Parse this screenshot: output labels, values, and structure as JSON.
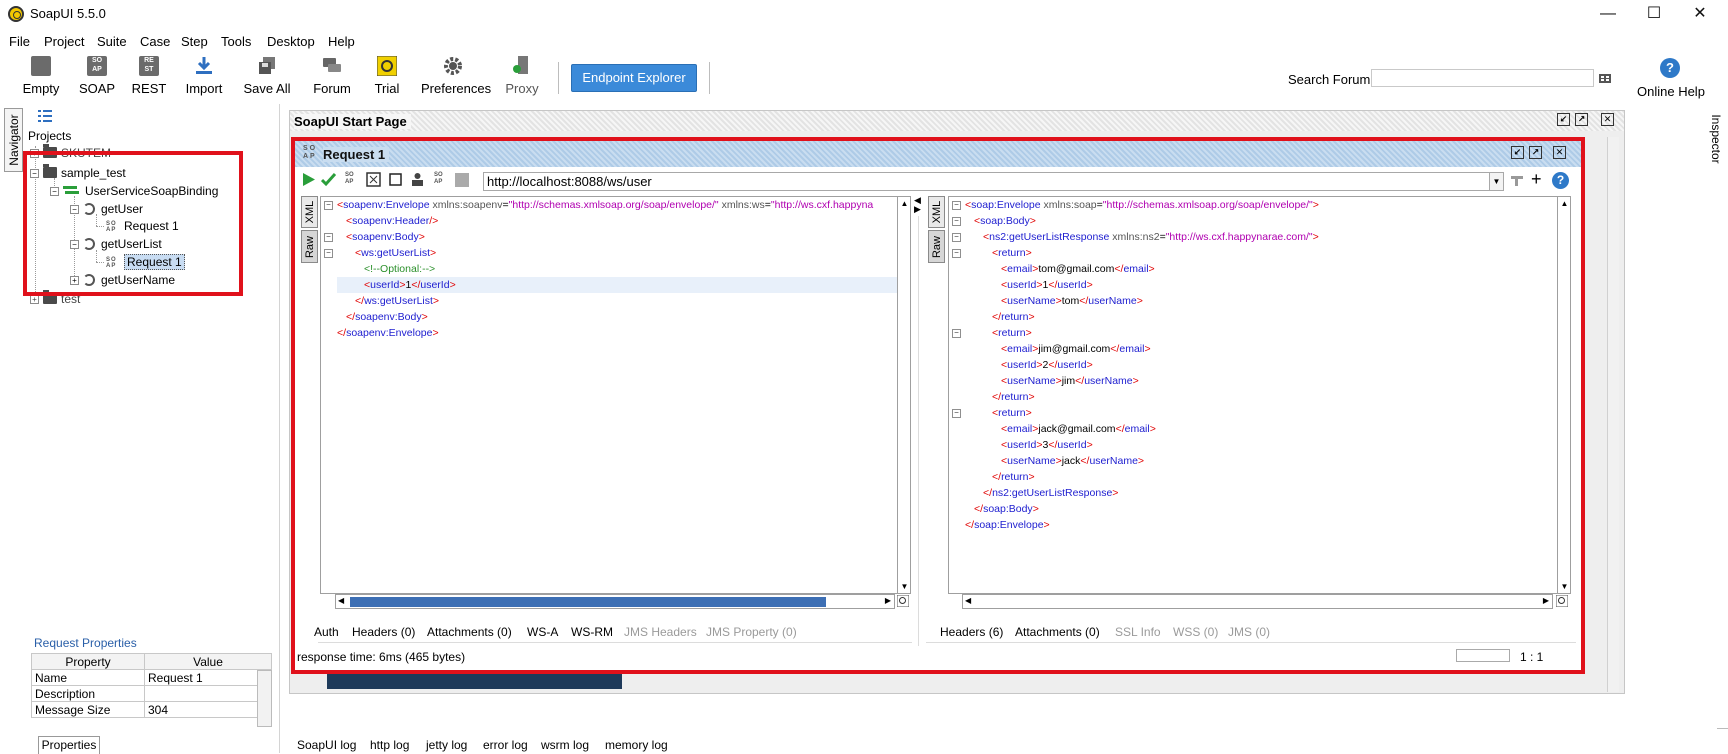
{
  "window": {
    "title": "SoapUI 5.5.0",
    "controls": {
      "minimize": "—",
      "maximize": "☐",
      "close": "✕"
    }
  },
  "menu": [
    "File",
    "Project",
    "Suite",
    "Case",
    "Step",
    "Tools",
    "Desktop",
    "Help"
  ],
  "toolbar": {
    "items": [
      {
        "label": "Empty",
        "icon": "empty-project-icon"
      },
      {
        "label": "SOAP",
        "icon": "soap-project-icon"
      },
      {
        "label": "REST",
        "icon": "rest-project-icon"
      },
      {
        "label": "Import",
        "icon": "import-icon"
      },
      {
        "label": "Save All",
        "icon": "save-all-icon"
      },
      {
        "label": "Forum",
        "icon": "forum-icon"
      },
      {
        "label": "Trial",
        "icon": "trial-icon"
      },
      {
        "label": "Preferences",
        "icon": "preferences-gear-icon"
      },
      {
        "label": "Proxy",
        "icon": "proxy-icon"
      }
    ],
    "endpoint_explorer": "Endpoint Explorer",
    "search_label": "Search Forum",
    "search_value": "",
    "online_help": "Online Help"
  },
  "navigator": {
    "tab_label": "Navigator",
    "root": "Projects",
    "projects_partial": "SKUTEM",
    "project": "sample_test",
    "binding": "UserServiceSoapBinding",
    "operations": [
      {
        "name": "getUser",
        "request": "Request 1"
      },
      {
        "name": "getUserList",
        "request": "Request 1"
      },
      {
        "name": "getUserName"
      }
    ],
    "other_project": "test"
  },
  "request_properties": {
    "title": "Request Properties",
    "columns": [
      "Property",
      "Value"
    ],
    "rows": [
      {
        "property": "Name",
        "value": "Request 1"
      },
      {
        "property": "Description",
        "value": ""
      },
      {
        "property": "Message Size",
        "value": "304"
      }
    ],
    "tab": "Properties"
  },
  "start_page": {
    "title": "SoapUI Start Page"
  },
  "request": {
    "title": "Request 1",
    "url": "http://localhost:8088/ws/user",
    "request_tabs": [
      "XML",
      "Raw"
    ],
    "response_tabs": [
      "XML",
      "Raw"
    ],
    "request_bottom_tabs": [
      {
        "label": "Auth",
        "enabled": true
      },
      {
        "label": "Headers (0)",
        "enabled": true
      },
      {
        "label": "Attachments (0)",
        "enabled": true
      },
      {
        "label": "WS-A",
        "enabled": true
      },
      {
        "label": "WS-RM",
        "enabled": true
      },
      {
        "label": "JMS Headers",
        "enabled": false
      },
      {
        "label": "JMS Property (0)",
        "enabled": false
      }
    ],
    "response_bottom_tabs": [
      {
        "label": "Headers (6)",
        "enabled": true
      },
      {
        "label": "Attachments (0)",
        "enabled": true
      },
      {
        "label": "SSL Info",
        "enabled": false
      },
      {
        "label": "WSS (0)",
        "enabled": false
      },
      {
        "label": "JMS (0)",
        "enabled": false
      }
    ],
    "status": "response time: 6ms (465 bytes)",
    "cursor": "1 : 1"
  },
  "inspector": {
    "label": "Inspector"
  },
  "logs": [
    "SoapUI log",
    "http log",
    "jetty log",
    "error log",
    "wsrm log",
    "memory log"
  ],
  "colors": {
    "accent": "#3b8ad9",
    "highlight_box": "#e0111b"
  }
}
